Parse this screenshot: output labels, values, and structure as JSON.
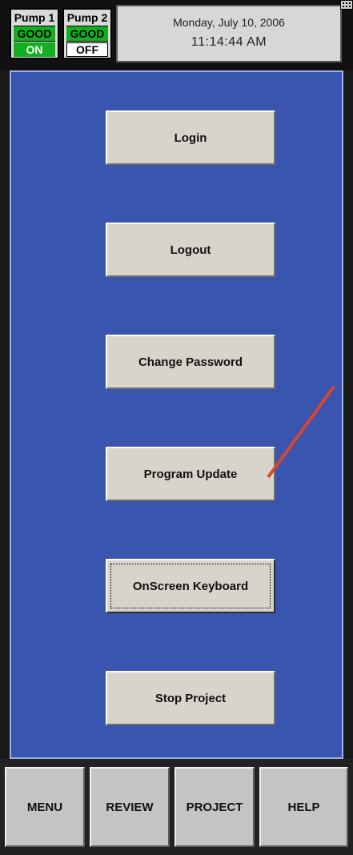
{
  "header": {
    "pumps": [
      {
        "name": "Pump 1",
        "status": "GOOD",
        "state": "ON"
      },
      {
        "name": "Pump 2",
        "status": "GOOD",
        "state": "OFF"
      }
    ],
    "date": "Monday, July 10, 2006",
    "time": "11:14:44 AM",
    "keyboard_icon": "keyboard-icon"
  },
  "menu": {
    "buttons": [
      {
        "label": "Login"
      },
      {
        "label": "Logout"
      },
      {
        "label": "Change Password"
      },
      {
        "label": "Program Update"
      },
      {
        "label": "OnScreen Keyboard",
        "focused": true
      },
      {
        "label": "Stop Project"
      }
    ]
  },
  "nav": {
    "buttons": [
      {
        "label": "MENU"
      },
      {
        "label": "REVIEW"
      },
      {
        "label": "PROJECT"
      },
      {
        "label": "HELP"
      }
    ]
  },
  "colors": {
    "panel_background": "#3a55b0",
    "status_good": "#12b020",
    "annotation_arrow": "#d9452e"
  }
}
